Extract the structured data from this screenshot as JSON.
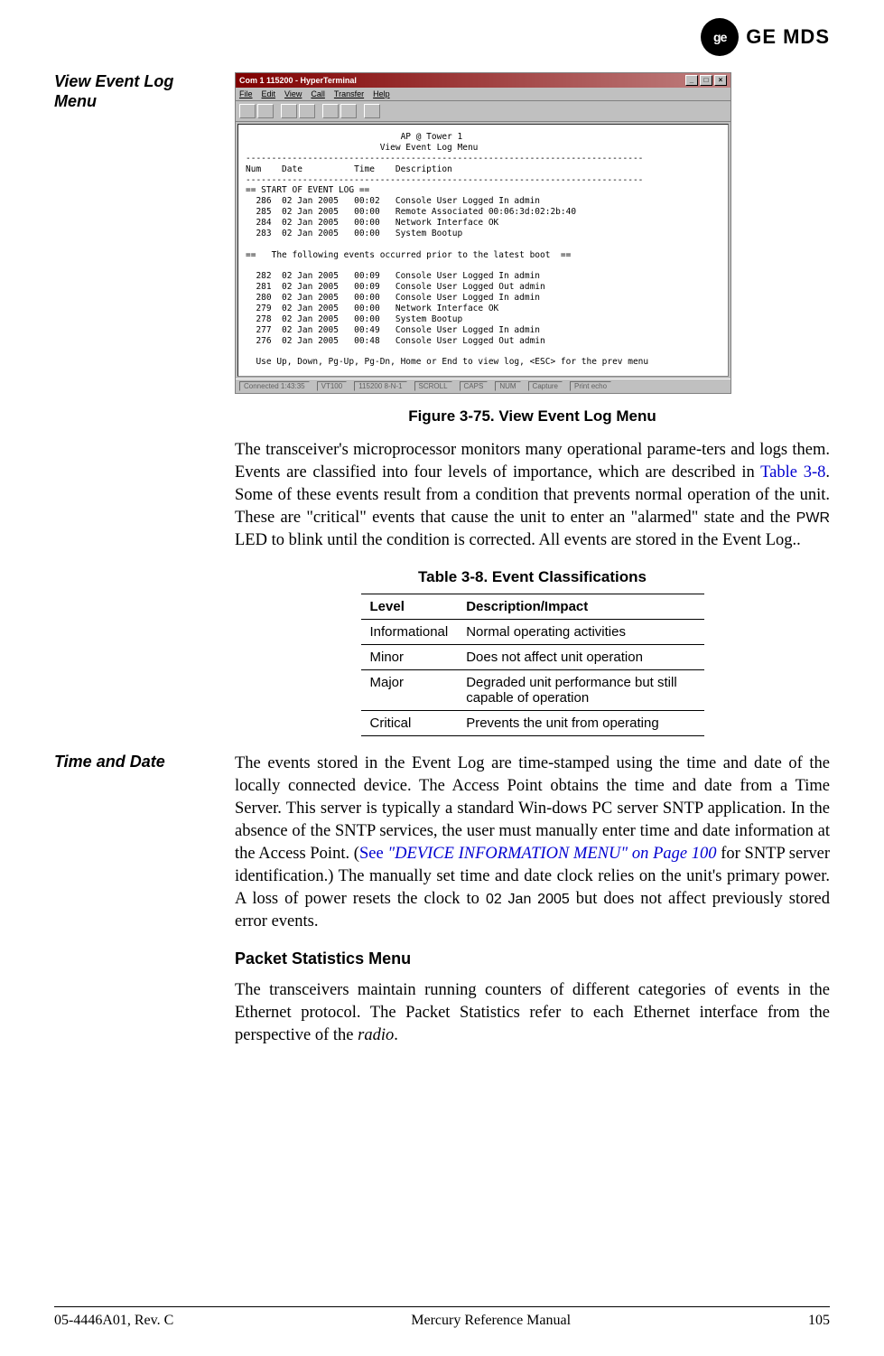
{
  "logo": {
    "monogram": "ge",
    "brand": "GE MDS"
  },
  "sidebar": {
    "heading1_line1": "View Event Log",
    "heading1_line2": "Menu",
    "heading2": "Time and Date"
  },
  "terminal": {
    "title": "Com 1 115200 - HyperTerminal",
    "menus": {
      "file": "File",
      "edit": "Edit",
      "view": "View",
      "call": "Call",
      "transfer": "Transfer",
      "help": "Help"
    },
    "body": "                              AP @ Tower 1\n                          View Event Log Menu\n-----------------------------------------------------------------------------\nNum    Date          Time    Description\n-----------------------------------------------------------------------------\n== START OF EVENT LOG ==\n  286  02 Jan 2005   00:02   Console User Logged In admin\n  285  02 Jan 2005   00:00   Remote Associated 00:06:3d:02:2b:40\n  284  02 Jan 2005   00:00   Network Interface OK\n  283  02 Jan 2005   00:00   System Bootup\n\n==   The following events occurred prior to the latest boot  ==\n\n  282  02 Jan 2005   00:09   Console User Logged In admin\n  281  02 Jan 2005   00:09   Console User Logged Out admin\n  280  02 Jan 2005   00:00   Console User Logged In admin\n  279  02 Jan 2005   00:00   Network Interface OK\n  278  02 Jan 2005   00:00   System Bootup\n  277  02 Jan 2005   00:49   Console User Logged In admin\n  276  02 Jan 2005   00:48   Console User Logged Out admin\n\n  Use Up, Down, Pg-Up, Pg-Dn, Home or End to view log, <ESC> for the prev menu",
    "status": {
      "connected": "Connected 1:43:35",
      "emu": "VT100",
      "port": "115200 8-N-1",
      "scroll": "SCROLL",
      "caps": "CAPS",
      "num": "NUM",
      "capture": "Capture",
      "echo": "Print echo"
    }
  },
  "figure_caption": "Figure 3-75. View Event Log Menu",
  "para1": {
    "pre": "The transceiver's microprocessor monitors many operational parame-ters and logs them. Events are classified into four levels of importance, which are described in ",
    "link": "Table 3-8",
    "mid": ". Some of these events result from a condition that prevents normal operation of the unit. These are \"critical\" events that cause the unit to enter an \"alarmed\" state and the ",
    "mono": "PWR",
    "post": " LED to blink until the condition is corrected. All events are stored in the Event Log.."
  },
  "table": {
    "caption": "Table 3-8. Event Classifications",
    "headers": {
      "level": "Level",
      "desc": "Description/Impact"
    },
    "rows": [
      {
        "level": "Informational",
        "desc": "Normal operating activities"
      },
      {
        "level": "Minor",
        "desc": "Does not affect unit operation"
      },
      {
        "level": "Major",
        "desc": "Degraded unit performance but still capable of operation"
      },
      {
        "level": "Critical",
        "desc": "Prevents the unit from operating"
      }
    ]
  },
  "para2": {
    "pre": "The events stored in the Event Log are time-stamped using the time and date of the locally connected device. The Access Point obtains the time and date from a Time Server. This server is typically a standard Win-dows PC server SNTP application. In the absence of the SNTP services, the user must manually enter time and date information at the Access Point. (",
    "see": "See ",
    "linkquote": "\"DEVICE INFORMATION MENU\" on Page 100",
    "mid": " for SNTP server identification.) The manually set time and date clock relies on the unit's primary power. A loss of power resets the clock to ",
    "mono": "02 Jan 2005",
    "post": " but does not affect previously stored error events."
  },
  "subheading": "Packet Statistics Menu",
  "para3": {
    "pre": "The transceivers maintain running counters of different categories of events in the Ethernet protocol. The Packet Statistics refer to each Ethernet interface from the perspective of the ",
    "ital": "radio",
    "post": "."
  },
  "footer": {
    "left": "05-4446A01, Rev. C",
    "center": "Mercury Reference Manual",
    "right": "105"
  }
}
